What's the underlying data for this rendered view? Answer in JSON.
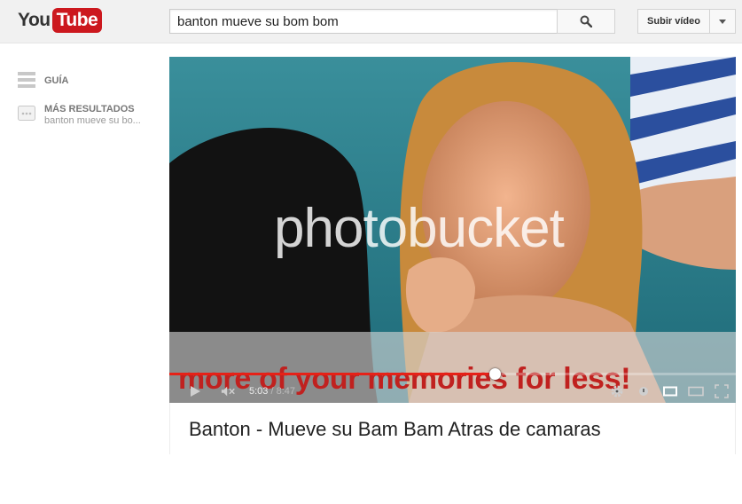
{
  "header": {
    "logo_you": "You",
    "logo_tube": "Tube",
    "search_value": "banton mueve su bom bom",
    "upload_label": "Subir vídeo",
    "brand_red": "#cc181e"
  },
  "sidebar": {
    "items": [
      {
        "label": "GUÍA",
        "icon": "menu-icon"
      },
      {
        "label": "MÁS RESULTADOS",
        "sublabel": "banton mueve su bo...",
        "icon": "results-icon"
      }
    ]
  },
  "player": {
    "watermark": "photobucket",
    "banner": "more of your memories for less!",
    "current_time": "5:03",
    "separator": "/",
    "duration": "8:47",
    "progress": 0.575,
    "progress_color": "#e62117"
  },
  "video": {
    "title": "Banton - Mueve su Bam Bam Atras de camaras"
  }
}
